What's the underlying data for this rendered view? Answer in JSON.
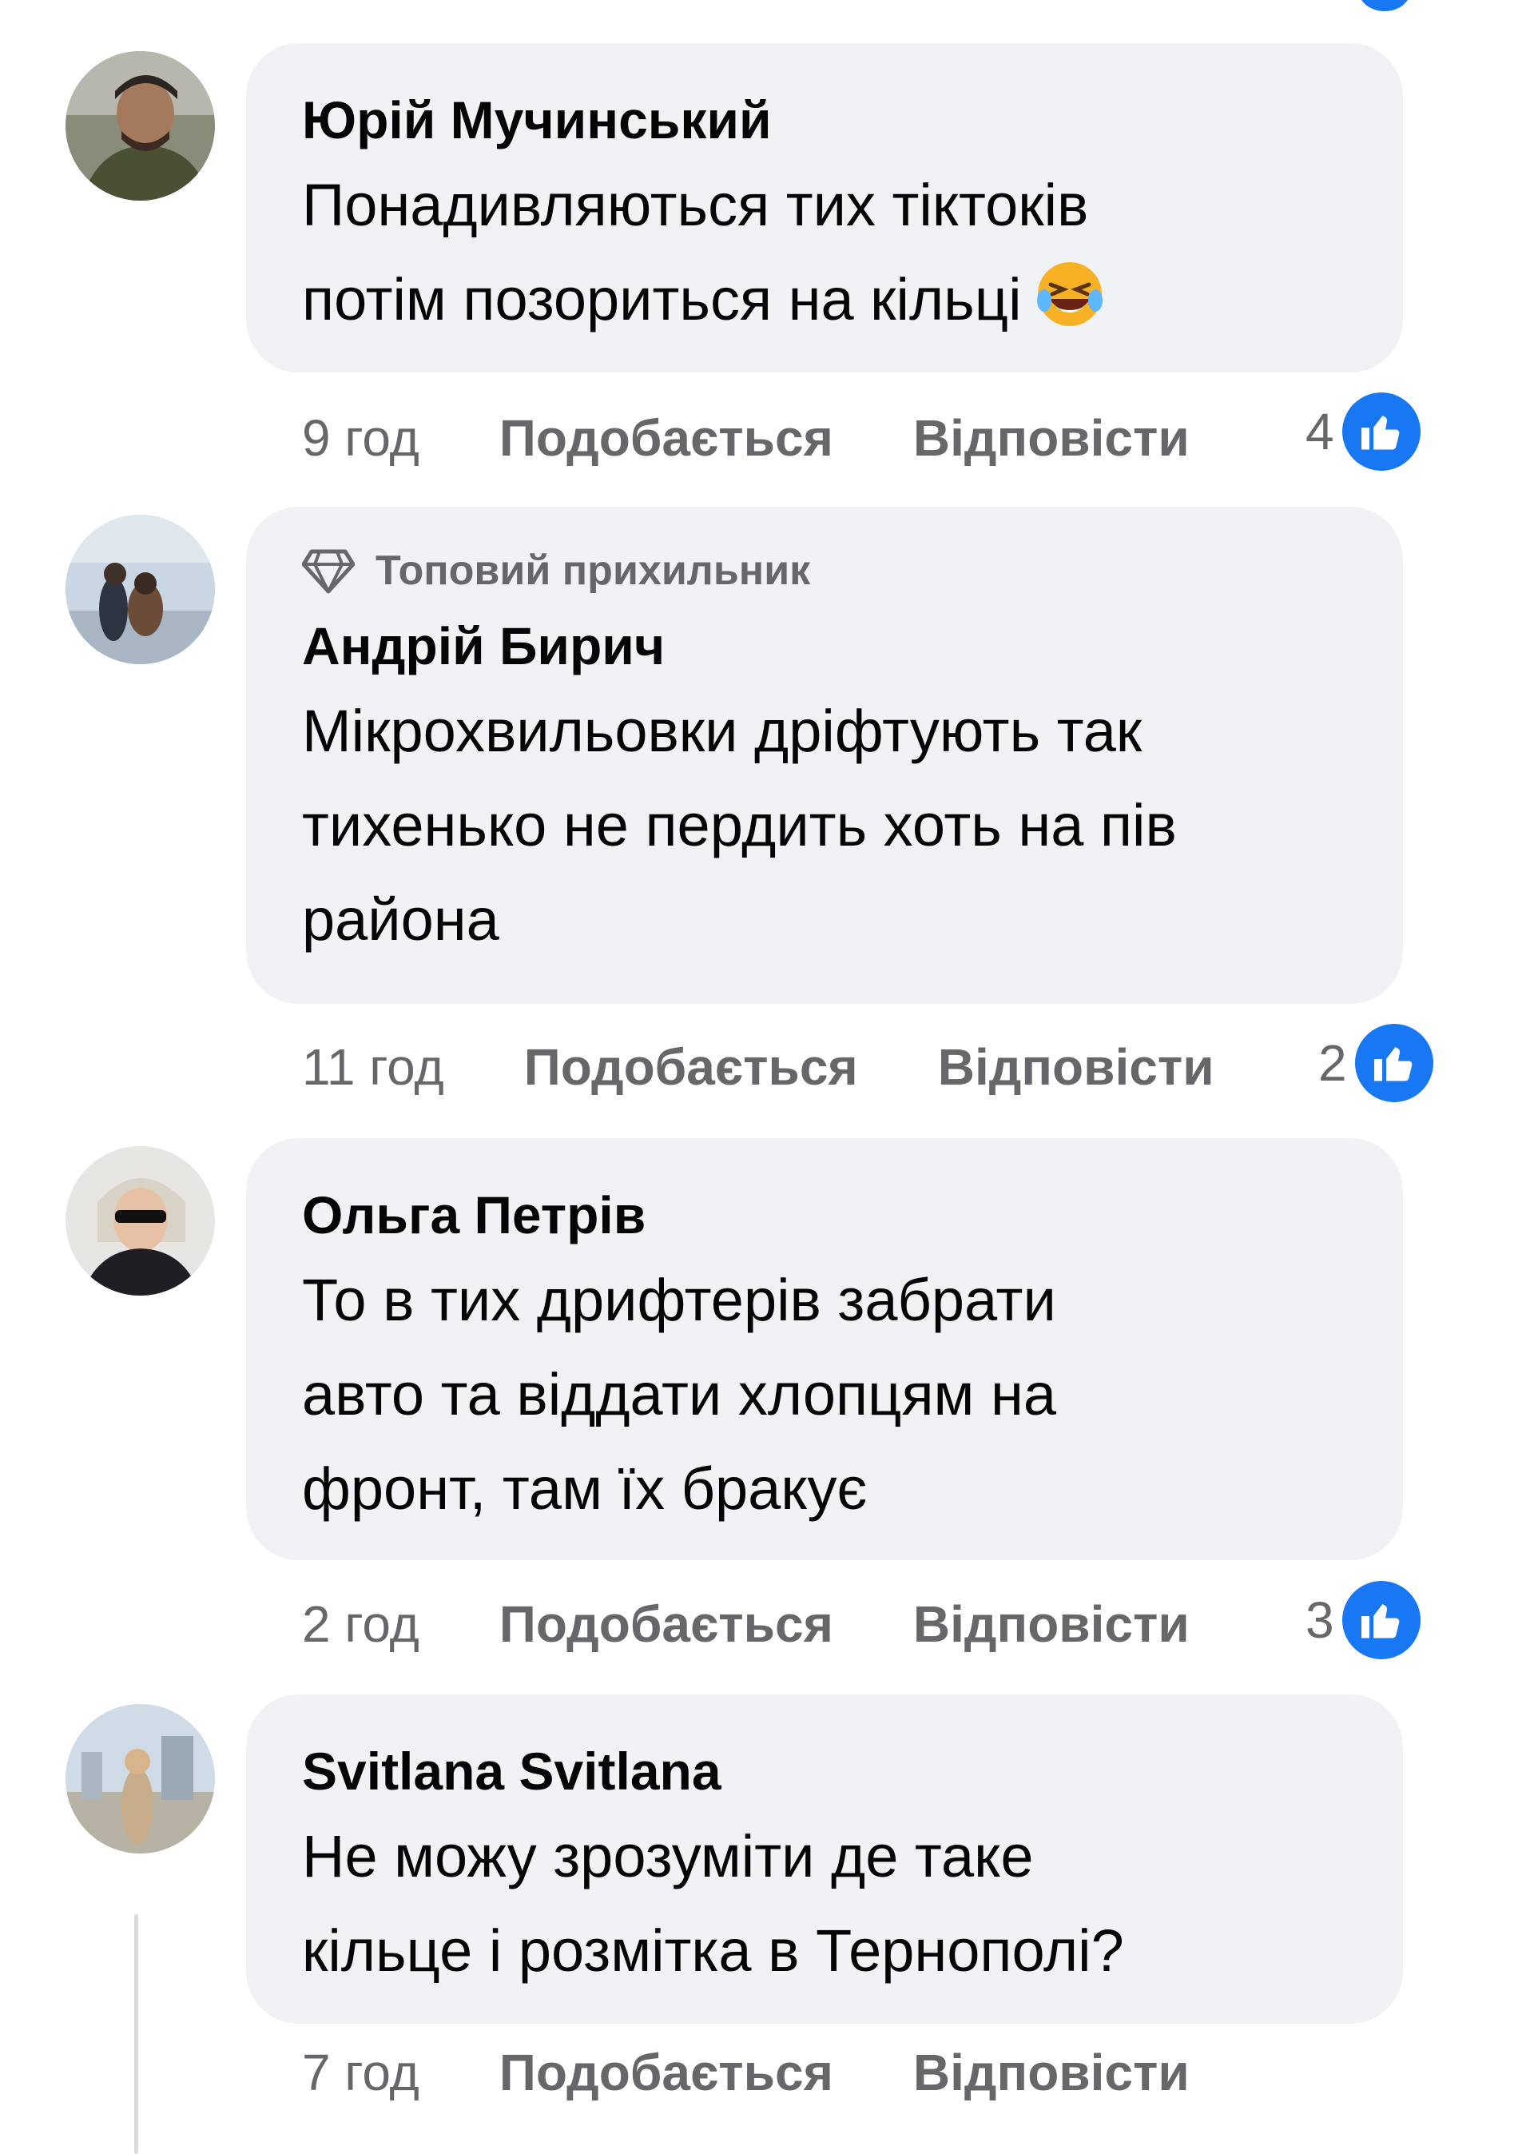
{
  "colors": {
    "bubble_bg": "#f0f2f5",
    "meta_text": "#65676b",
    "like_blue": "#1877f2",
    "name_text": "#050505"
  },
  "comments": [
    {
      "badge": null,
      "author": "Юрій Мучинський",
      "lines": [
        "Понадивляються тих тіктоків",
        "потім позориться на кільці"
      ],
      "emoji": "rolling-on-floor-laughing-emoji",
      "time": "9 год",
      "like_label": "Подобається",
      "reply_label": "Відповісти",
      "reaction_count": "4",
      "reaction_icon": "like-icon"
    },
    {
      "badge": "Топовий прихильник",
      "badge_icon": "diamond-icon",
      "author": "Андрій Бирич",
      "lines": [
        "Мікрохвильовки дріфтують так",
        "тихенько не пердить хоть на пів",
        "района"
      ],
      "time": "11 год",
      "like_label": "Подобається",
      "reply_label": "Відповісти",
      "reaction_count": "2",
      "reaction_icon": "like-icon"
    },
    {
      "badge": null,
      "author": "Ольга Петрів",
      "lines": [
        "То в тих дрифтерів забрати",
        "авто та віддати хлопцям на",
        "фронт, там їх бракує"
      ],
      "time": "2 год",
      "like_label": "Подобається",
      "reply_label": "Відповісти",
      "reaction_count": "3",
      "reaction_icon": "like-icon"
    },
    {
      "badge": null,
      "author": "Svitlana Svitlana",
      "lines": [
        "Не можу зрозуміти де таке",
        "кільце і розмітка в Тернополі?"
      ],
      "time": "7 год",
      "like_label": "Подобається",
      "reply_label": "Відповісти",
      "reaction_count": null
    }
  ]
}
